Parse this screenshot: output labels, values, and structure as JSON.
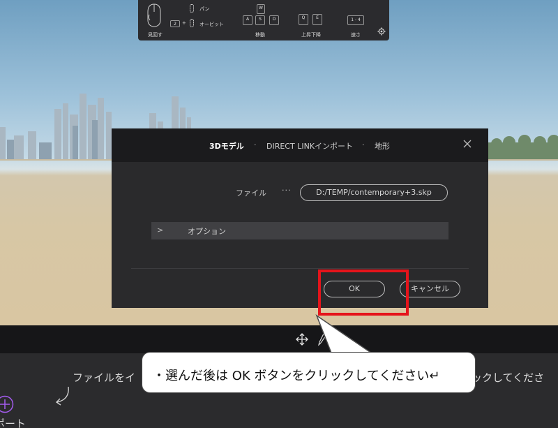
{
  "nav_panel": {
    "orbit_label": "見回す",
    "pan_label": "パン",
    "orbit2_label": "オービット",
    "move_label": "移動",
    "updown_label": "上昇下降",
    "speed_label": "速さ",
    "keys": {
      "mouse_combo": "2",
      "w": "W",
      "a": "A",
      "s": "S",
      "d": "D",
      "q": "Q",
      "e": "E",
      "speed": "1 - 4"
    }
  },
  "dialog": {
    "tabs": [
      "3Dモデル",
      "DIRECT LINKインポート",
      "地形"
    ],
    "separator": "·",
    "file_label": "ファイル",
    "browse_label": "···",
    "file_path": "D:/TEMP/contemporary+3.skp",
    "options_chevron": ">",
    "options_label": "オプション",
    "ok_label": "OK",
    "cancel_label": "キャンセル"
  },
  "bottom": {
    "hint_left": "ファイルをイ",
    "hint_right": "ックしてくださ",
    "import_label": "ポート"
  },
  "callout": {
    "text": "・選んだ後は OK ボタンをクリックしてください↵"
  },
  "colors": {
    "highlight": "#e5141b",
    "dialog_bg": "#2a2a2c",
    "header_bg": "#1b1b1d",
    "import_accent": "#a55cf0"
  }
}
